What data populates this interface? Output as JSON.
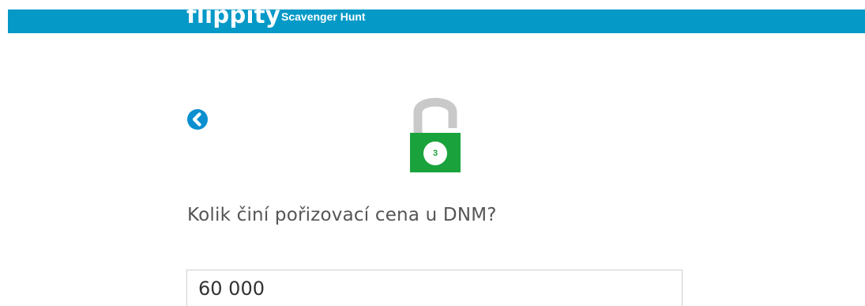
{
  "header": {
    "brand": "flippity",
    "app_title": "Scavenger Hunt"
  },
  "navigation": {
    "back_icon": "chevron-left-circle"
  },
  "lock": {
    "icon": "open-padlock",
    "number": "3",
    "shackle_color": "#c9c9c9",
    "body_color": "#1aa33c"
  },
  "question": {
    "text": "Kolik činí pořizovací cena u DNM?"
  },
  "answer": {
    "value": "60 000"
  },
  "colors": {
    "header_background": "#0499c7",
    "accent": "#0a8fd0",
    "question_text": "#555555"
  }
}
